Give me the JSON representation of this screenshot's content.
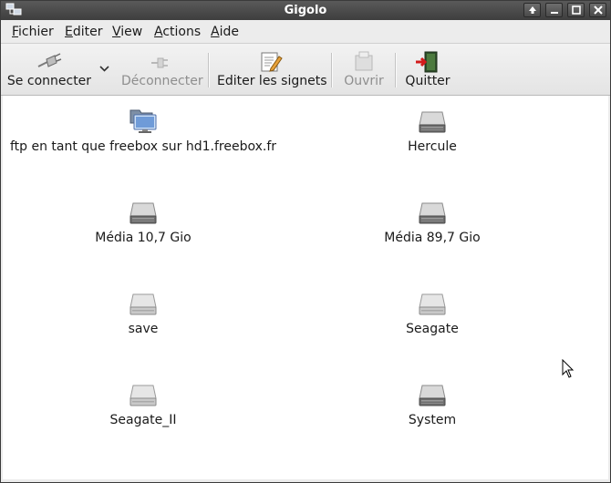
{
  "window": {
    "title": "Gigolo"
  },
  "menubar": {
    "items": [
      {
        "key": "F",
        "rest": "ichier"
      },
      {
        "key": "E",
        "rest": "diter"
      },
      {
        "key": "V",
        "rest": "iew"
      },
      {
        "key": "A",
        "rest": "ctions"
      },
      {
        "key": "A",
        "rest": "ide"
      }
    ]
  },
  "toolbar": {
    "connect": "Se connecter",
    "disconnect": "Déconnecter",
    "bookmarks": "Editer les signets",
    "open": "Ouvrir",
    "quit": "Quitter"
  },
  "items": [
    {
      "label": "ftp en tant que freebox sur hd1.freebox.fr",
      "icon": "network-folder-icon"
    },
    {
      "label": "Hercule",
      "icon": "drive-icon"
    },
    {
      "label": "Média 10,7 Gio",
      "icon": "drive-icon"
    },
    {
      "label": "Média 89,7 Gio",
      "icon": "drive-icon"
    },
    {
      "label": "save",
      "icon": "removable-drive-icon"
    },
    {
      "label": "Seagate",
      "icon": "removable-drive-icon"
    },
    {
      "label": "Seagate_II",
      "icon": "removable-drive-icon"
    },
    {
      "label": "System",
      "icon": "drive-icon"
    }
  ]
}
